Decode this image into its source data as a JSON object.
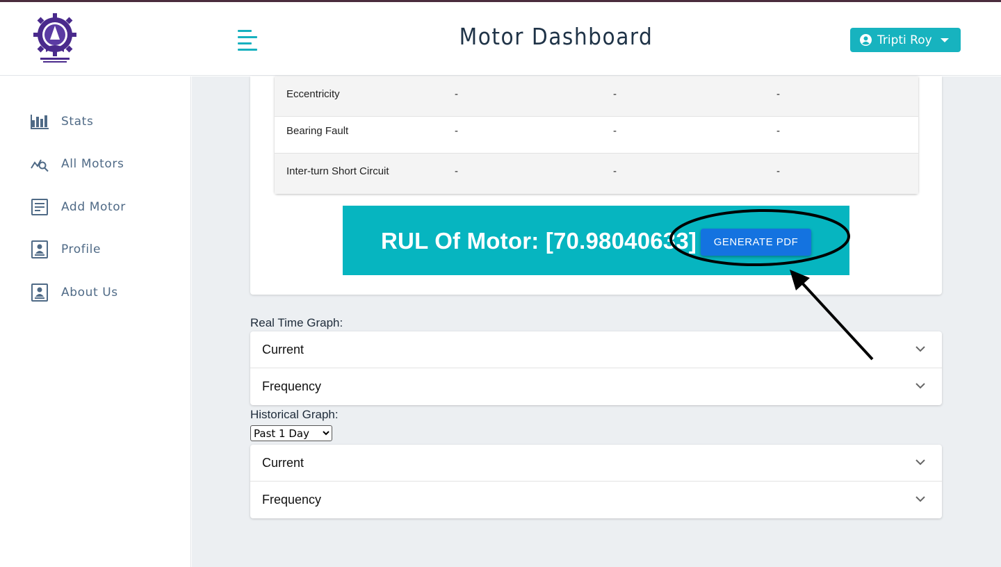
{
  "header": {
    "title": "Motor Dashboard",
    "user_name": "Tripti Roy",
    "accent_color": "#17b3bf",
    "icons": {
      "menu": "hamburger-menu-icon",
      "user": "user-circle-icon",
      "caret": "caret-down-icon"
    }
  },
  "sidebar": {
    "items": [
      {
        "label": "Stats",
        "icon": "bar-chart-icon"
      },
      {
        "label": "All Motors",
        "icon": "chart-search-icon"
      },
      {
        "label": "Add Motor",
        "icon": "form-icon"
      },
      {
        "label": "Profile",
        "icon": "profile-card-icon"
      },
      {
        "label": "About Us",
        "icon": "profile-card-icon"
      }
    ]
  },
  "fault_table": {
    "rows": [
      {
        "name": "Eccentricity",
        "v1": "-",
        "v2": "-",
        "v3": "-"
      },
      {
        "name": "Bearing Fault",
        "v1": "-",
        "v2": "-",
        "v3": "-"
      },
      {
        "name": "Inter-turn Short Circuit",
        "v1": "-",
        "v2": "-",
        "v3": "-"
      }
    ]
  },
  "rul": {
    "text": "RUL Of Motor: [70.98040633]",
    "button_label": "GENERATE PDF",
    "box_color": "#06b5c0",
    "button_color": "#1473e0"
  },
  "real_time": {
    "label": "Real Time Graph:",
    "panels": [
      "Current",
      "Frequency"
    ]
  },
  "historical": {
    "label": "Historical Graph:",
    "selected_range": "Past 1 Day",
    "panels": [
      "Current",
      "Frequency"
    ]
  }
}
